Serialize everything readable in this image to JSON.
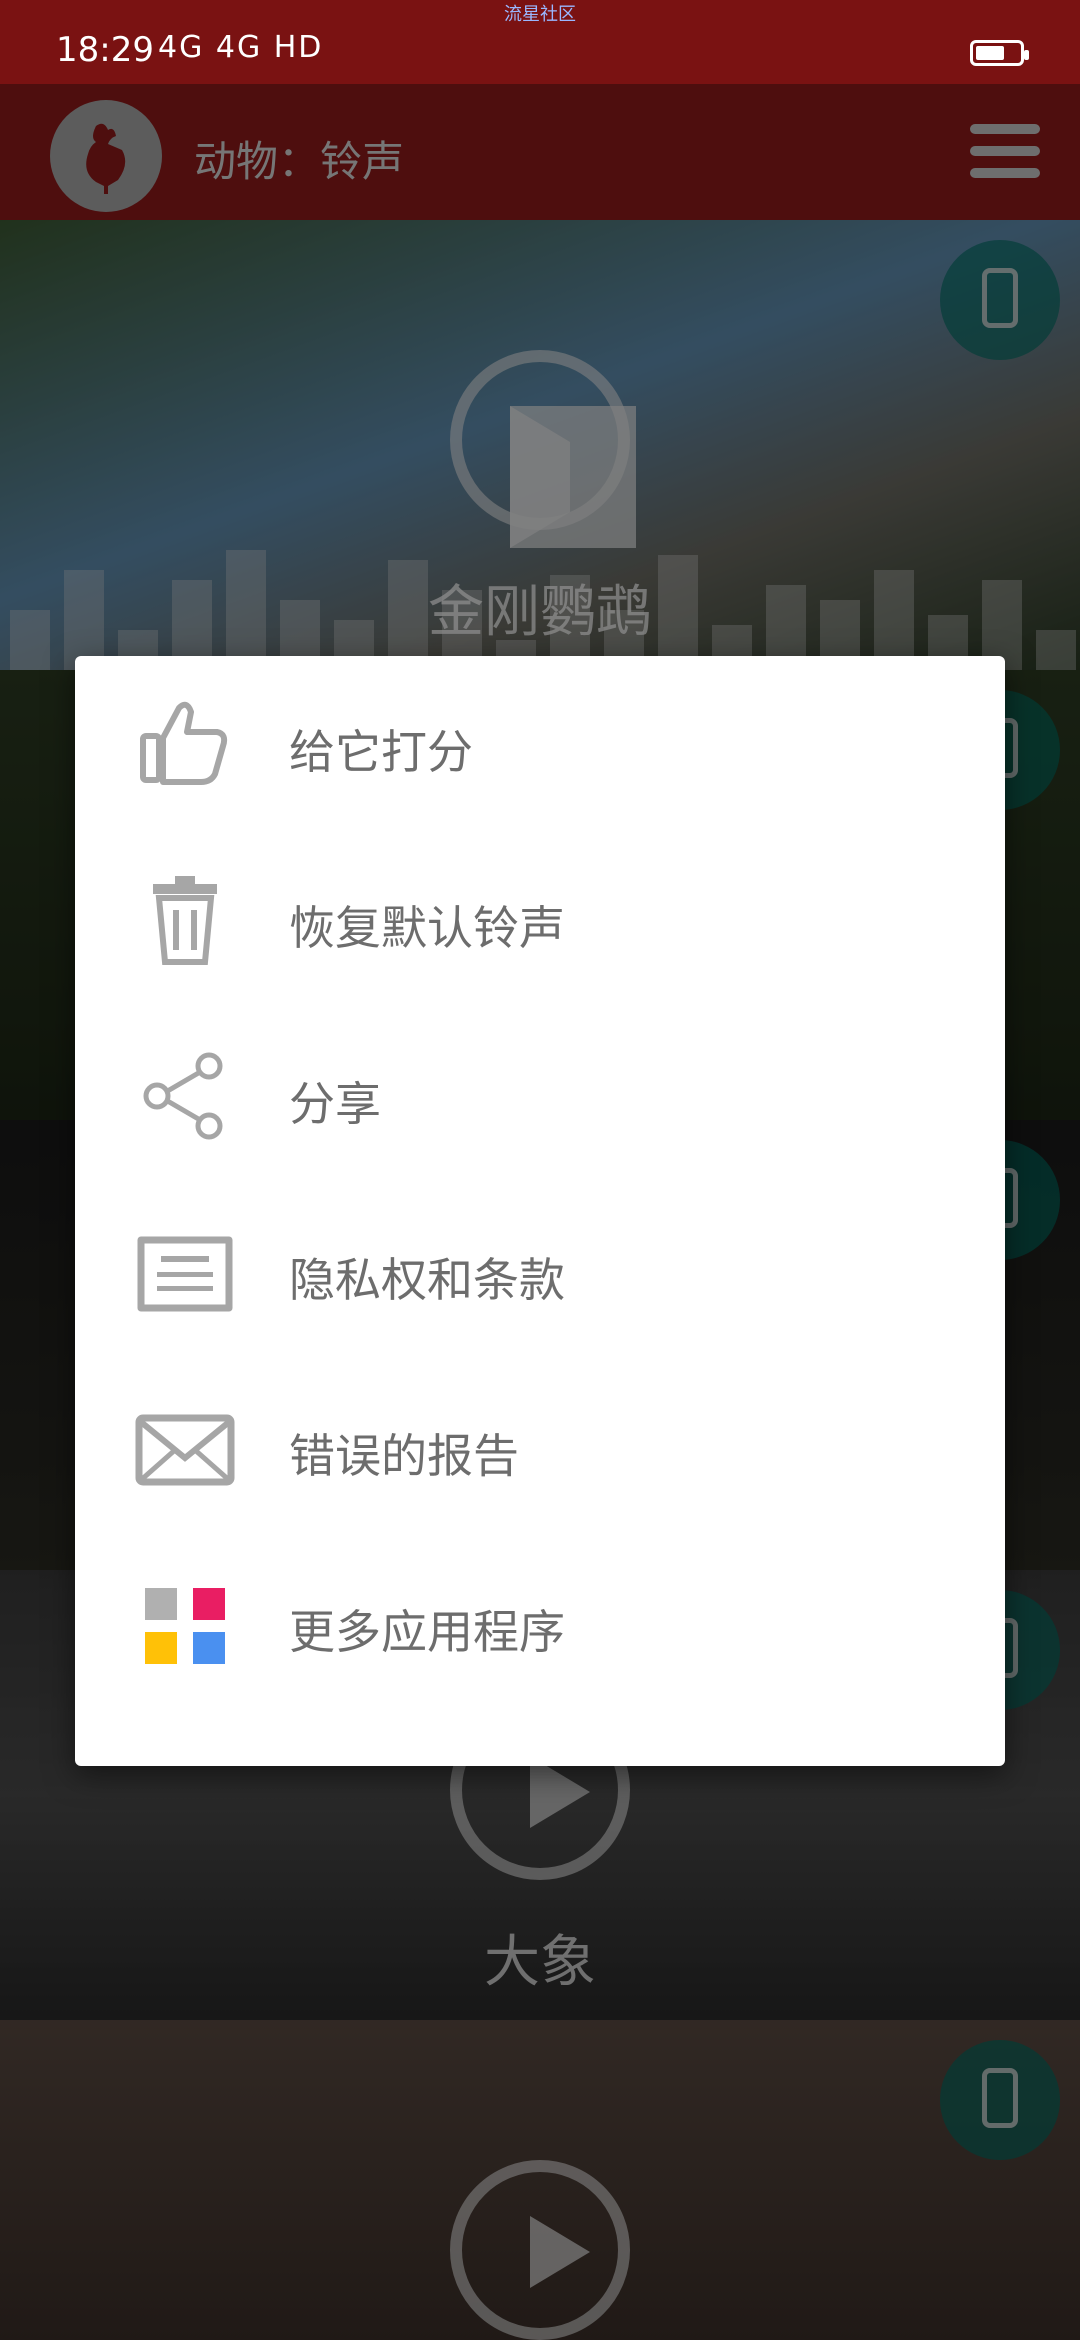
{
  "status_bar": {
    "watermark": "流星社区",
    "time": "18:29",
    "network": "4G 4G HD"
  },
  "app_bar": {
    "title": "动物：铃声",
    "logo_icon": "rooster-icon",
    "menu_icon": "hamburger-menu-icon"
  },
  "tiles": [
    {
      "name": "金刚鹦鹉",
      "state": "pause",
      "bg": "parrot"
    },
    {
      "name": "",
      "state": "play",
      "bg": "dark-green"
    },
    {
      "name": "",
      "state": "play",
      "bg": "dark"
    },
    {
      "name": "大象",
      "state": "play",
      "bg": "elephants"
    },
    {
      "name": "",
      "state": "play",
      "bg": "hippo"
    }
  ],
  "menu": {
    "items": [
      {
        "label": "给它打分",
        "icon": "thumbs-up-icon"
      },
      {
        "label": "恢复默认铃声",
        "icon": "trash-icon"
      },
      {
        "label": "分享",
        "icon": "share-icon"
      },
      {
        "label": "隐私权和条款",
        "icon": "document-icon"
      },
      {
        "label": "错误的报告",
        "icon": "mail-icon"
      },
      {
        "label": "更多应用程序",
        "icon": "apps-grid-icon"
      }
    ]
  },
  "colors": {
    "status_bar": "#7a1212",
    "app_bar": "#8f1b1b",
    "grid_red": "#e91e63",
    "grid_yellow": "#ffc107",
    "grid_blue": "#4a90f0",
    "grid_gray": "#b0b0b0"
  }
}
